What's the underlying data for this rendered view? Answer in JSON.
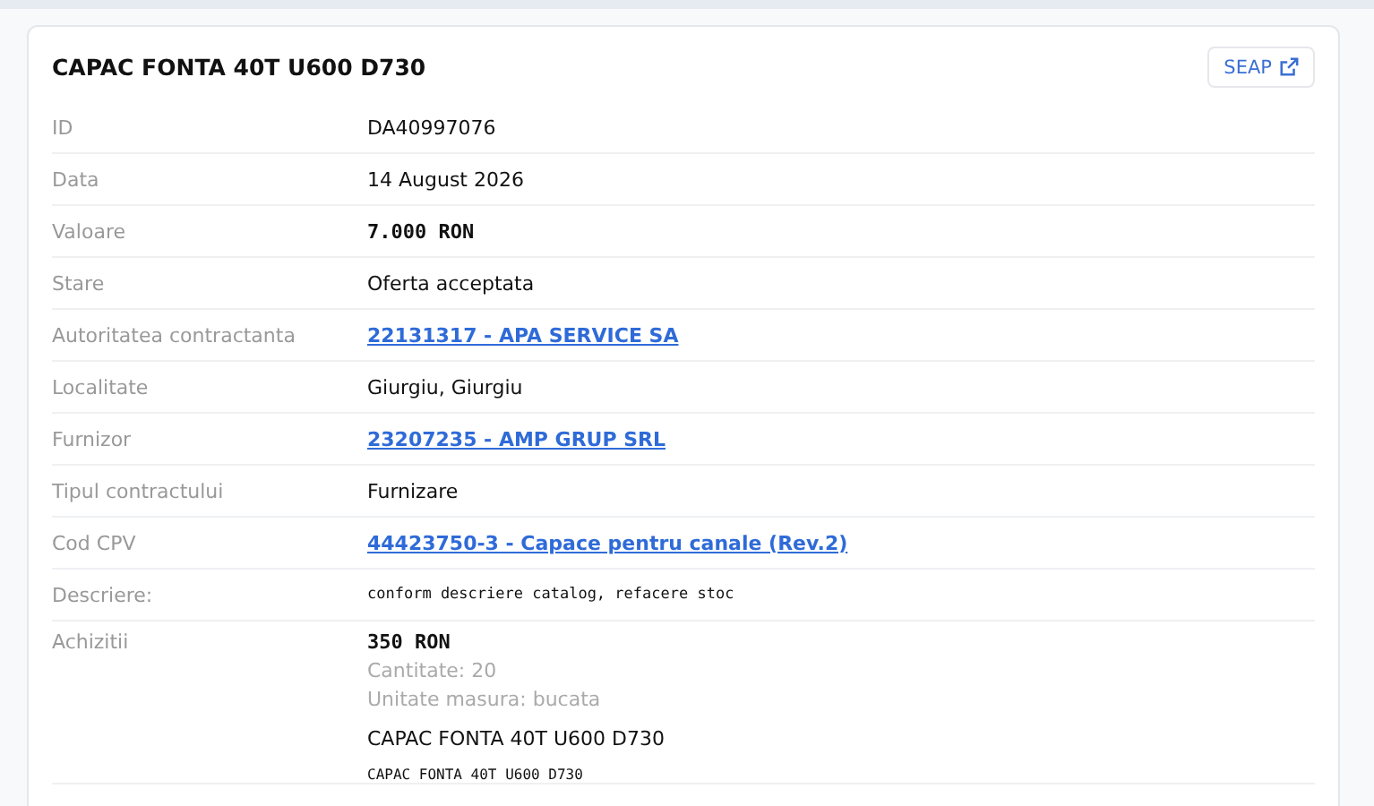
{
  "title": "CAPAC FONTA 40T U600 D730",
  "header_button": {
    "label": "SEAP"
  },
  "rows": [
    {
      "label": "ID",
      "kind": "text",
      "value": "DA40997076"
    },
    {
      "label": "Data",
      "kind": "text",
      "value": "14 August 2026"
    },
    {
      "label": "Valoare",
      "kind": "amount",
      "value": "7.000 RON"
    },
    {
      "label": "Stare",
      "kind": "text",
      "value": "Oferta acceptata"
    },
    {
      "label": "Autoritatea contractanta",
      "kind": "link",
      "value": "22131317 - APA SERVICE SA"
    },
    {
      "label": "Localitate",
      "kind": "text",
      "value": "Giurgiu, Giurgiu"
    },
    {
      "label": "Furnizor",
      "kind": "link",
      "value": "23207235 - AMP GRUP SRL"
    },
    {
      "label": "Tipul contractului",
      "kind": "text",
      "value": "Furnizare"
    },
    {
      "label": "Cod CPV",
      "kind": "link",
      "value": "44423750-3 - Capace pentru canale (Rev.2)"
    },
    {
      "label": "Descriere:",
      "kind": "mono",
      "value": "conform descriere catalog, refacere stoc"
    }
  ],
  "purchases": {
    "label": "Achizitii",
    "items": [
      {
        "price": "350 RON",
        "quantity": "Cantitate: 20",
        "unit": "Unitate masura: bucata",
        "name": "CAPAC FONTA 40T U600 D730",
        "description": "CAPAC FONTA 40T U600 D730"
      }
    ]
  }
}
